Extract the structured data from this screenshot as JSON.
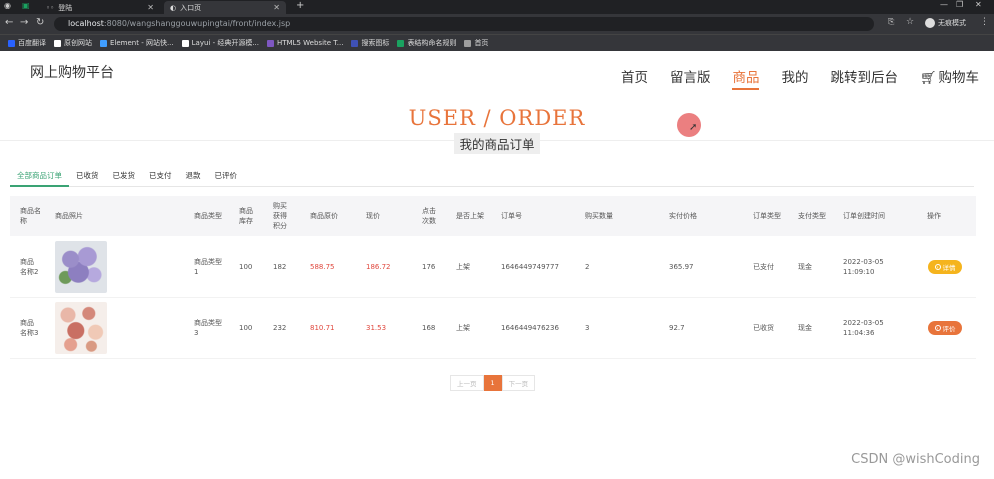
{
  "browser": {
    "tabs": [
      {
        "label": "登陆",
        "active": false
      },
      {
        "label": "入口页",
        "active": true
      }
    ],
    "new_tab": "+",
    "url_host": "localhost",
    "url_rest": ":8080/wangshanggouwupingtai/front/index.jsp",
    "profile_label": "无痕模式",
    "bookmarks": [
      {
        "label": "百度翻译",
        "color": "#2962ff"
      },
      {
        "label": "原创网站",
        "color": "#ffffff"
      },
      {
        "label": "Element - 网站快...",
        "color": "#409eff"
      },
      {
        "label": "Layui - 经典开源模...",
        "color": "#ffffff"
      },
      {
        "label": "HTML5 Website T...",
        "color": "#7e57c2"
      },
      {
        "label": "搜索图标",
        "color": "#3f51b5"
      },
      {
        "label": "表结构命名规则",
        "color": "#1aa260"
      },
      {
        "label": "首页",
        "color": "#9e9e9e"
      }
    ]
  },
  "header": {
    "logo": "网上购物平台",
    "nav": [
      {
        "label": "首页",
        "active": false
      },
      {
        "label": "留言版",
        "active": false
      },
      {
        "label": "商品",
        "active": true
      },
      {
        "label": "我的",
        "active": false
      },
      {
        "label": "跳转到后台",
        "active": false
      },
      {
        "label": "购物车",
        "active": false,
        "icon": "cart-icon"
      }
    ]
  },
  "page": {
    "title_en": "USER / ORDER",
    "title_cn": "我的商品订单"
  },
  "filter_tabs": [
    {
      "label": "全部商品订单",
      "active": true
    },
    {
      "label": "已收货",
      "active": false
    },
    {
      "label": "已发货",
      "active": false
    },
    {
      "label": "已支付",
      "active": false
    },
    {
      "label": "退款",
      "active": false
    },
    {
      "label": "已评价",
      "active": false
    }
  ],
  "table": {
    "headers": [
      "商品名称",
      "商品照片",
      "商品类型",
      "商品库存",
      "购买获得积分",
      "商品原价",
      "现价",
      "点击次数",
      "是否上架",
      "订单号",
      "购买数量",
      "实付价格",
      "订单类型",
      "支付类型",
      "订单创建时间",
      "操作"
    ],
    "rows": [
      {
        "name": "商品名称2",
        "type": "商品类型1",
        "stock": "100",
        "points": "182",
        "orig_price": "588.75",
        "price": "186.72",
        "clicks": "176",
        "listed": "上架",
        "order_no": "1646449749777",
        "qty": "2",
        "paid": "365.97",
        "order_type": "已支付",
        "pay_type": "现金",
        "created": "2022-03-05 11:09:10",
        "action": "详情",
        "action_color": "#f5b41d"
      },
      {
        "name": "商品名称3",
        "type": "商品类型3",
        "stock": "100",
        "points": "232",
        "orig_price": "810.71",
        "price": "31.53",
        "clicks": "168",
        "listed": "上架",
        "order_no": "1646449476236",
        "qty": "3",
        "paid": "92.7",
        "order_type": "已收货",
        "pay_type": "现金",
        "created": "2022-03-05 11:04:36",
        "action": "评价",
        "action_color": "#e8743b"
      }
    ]
  },
  "pager": {
    "prev": "上一页",
    "current": "1",
    "next": "下一页"
  },
  "watermark": "CSDN @wishCoding",
  "colors": {
    "accent": "#e8743b",
    "tab_active": "#3aa374",
    "price_red": "#e0483e"
  }
}
